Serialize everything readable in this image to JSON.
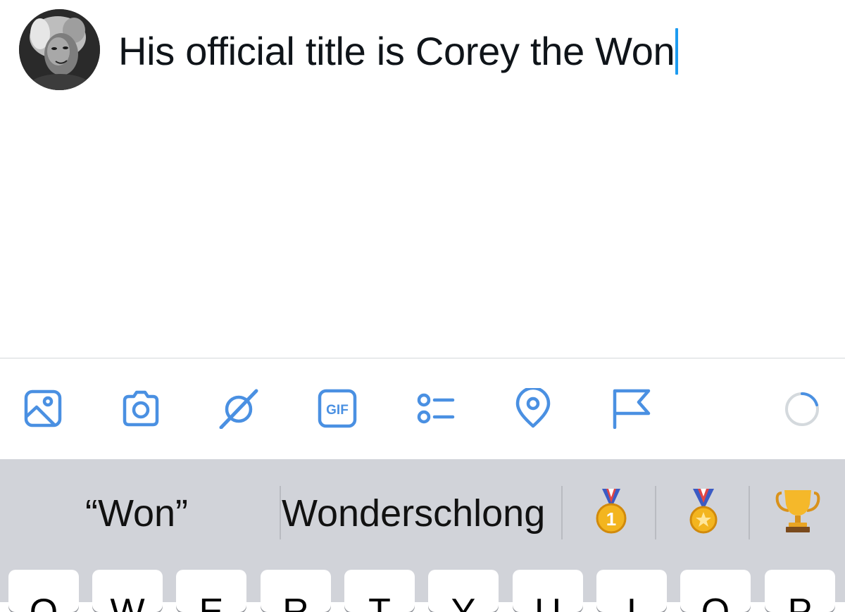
{
  "compose": {
    "text": "His official title is Corey the Won"
  },
  "toolbar": {
    "icons": [
      "image-icon",
      "camera-icon",
      "grok-icon",
      "gif-icon",
      "poll-icon",
      "location-icon",
      "flag-icon"
    ],
    "gif_label": "GIF",
    "accent": "#4a90e2",
    "progress": 0.0
  },
  "keyboard": {
    "suggestions": {
      "quoted": "“Won”",
      "word": "Wonderschlong"
    },
    "emojis": [
      "1st-place-medal",
      "sports-medal",
      "trophy"
    ],
    "top_row_keys": [
      "Q",
      "W",
      "E",
      "R",
      "T",
      "Y",
      "U",
      "I",
      "O",
      "P"
    ]
  }
}
